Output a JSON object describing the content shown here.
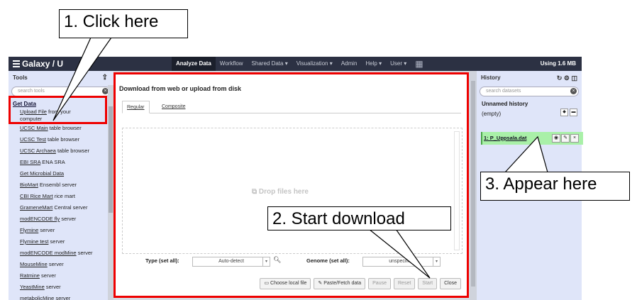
{
  "masthead": {
    "brand": "Galaxy / U",
    "nav": [
      "Analyze Data",
      "Workflow",
      "Shared Data ▾",
      "Visualization ▾",
      "Admin",
      "Help ▾",
      "User ▾"
    ],
    "usage": "Using 1.6 MB"
  },
  "tools": {
    "title": "Tools",
    "search_placeholder": "search tools",
    "section": "Get Data",
    "first_tool_link": "Upload File",
    "first_tool_rest": " from your computer",
    "items": [
      {
        "link": "UCSC Main",
        "rest": " table browser"
      },
      {
        "link": "UCSC Test",
        "rest": " table browser"
      },
      {
        "link": "UCSC Archaea",
        "rest": " table browser"
      },
      {
        "link": "EBI SRA",
        "rest": " ENA SRA"
      },
      {
        "link": "Get Microbial Data",
        "rest": ""
      },
      {
        "link": "BioMart",
        "rest": " Ensembl server"
      },
      {
        "link": "CBI Rice Mart",
        "rest": " rice mart"
      },
      {
        "link": "GrameneMart",
        "rest": " Central server"
      },
      {
        "link": "modENCODE fly",
        "rest": " server"
      },
      {
        "link": "Flymine",
        "rest": " server"
      },
      {
        "link": "Flymine test",
        "rest": " server"
      },
      {
        "link": "modENCODE modMine",
        "rest": " server"
      },
      {
        "link": "MouseMine",
        "rest": " server"
      },
      {
        "link": "Ratmine",
        "rest": " server"
      },
      {
        "link": "YeastMine",
        "rest": " server"
      },
      {
        "link": "metabolicMine",
        "rest": " server"
      }
    ]
  },
  "upload": {
    "title": "Download from web or upload from disk",
    "tab_regular": "Regular",
    "tab_composite": "Composite",
    "drop_text": "Drop files here",
    "type_label": "Type (set all):",
    "type_value": "Auto-detect",
    "genome_label": "Genome (set all):",
    "genome_value": "unspecified",
    "buttons": {
      "choose": "Choose local file",
      "paste": "Paste/Fetch data",
      "pause": "Pause",
      "reset": "Reset",
      "start": "Start",
      "close": "Close"
    }
  },
  "history": {
    "title": "History",
    "search_placeholder": "search datasets",
    "name": "Unnamed history",
    "status": "(empty)",
    "dataset": "1: P_Uppsala.dat"
  },
  "callouts": {
    "one": "1. Click here",
    "two": "2. Start download",
    "three": "3. Appear here"
  },
  "colors": {
    "masthead": "#2c3143",
    "panel": "#dfe5f9",
    "dataset_ok": "#a9f0a8",
    "highlight": "#ee0000"
  }
}
